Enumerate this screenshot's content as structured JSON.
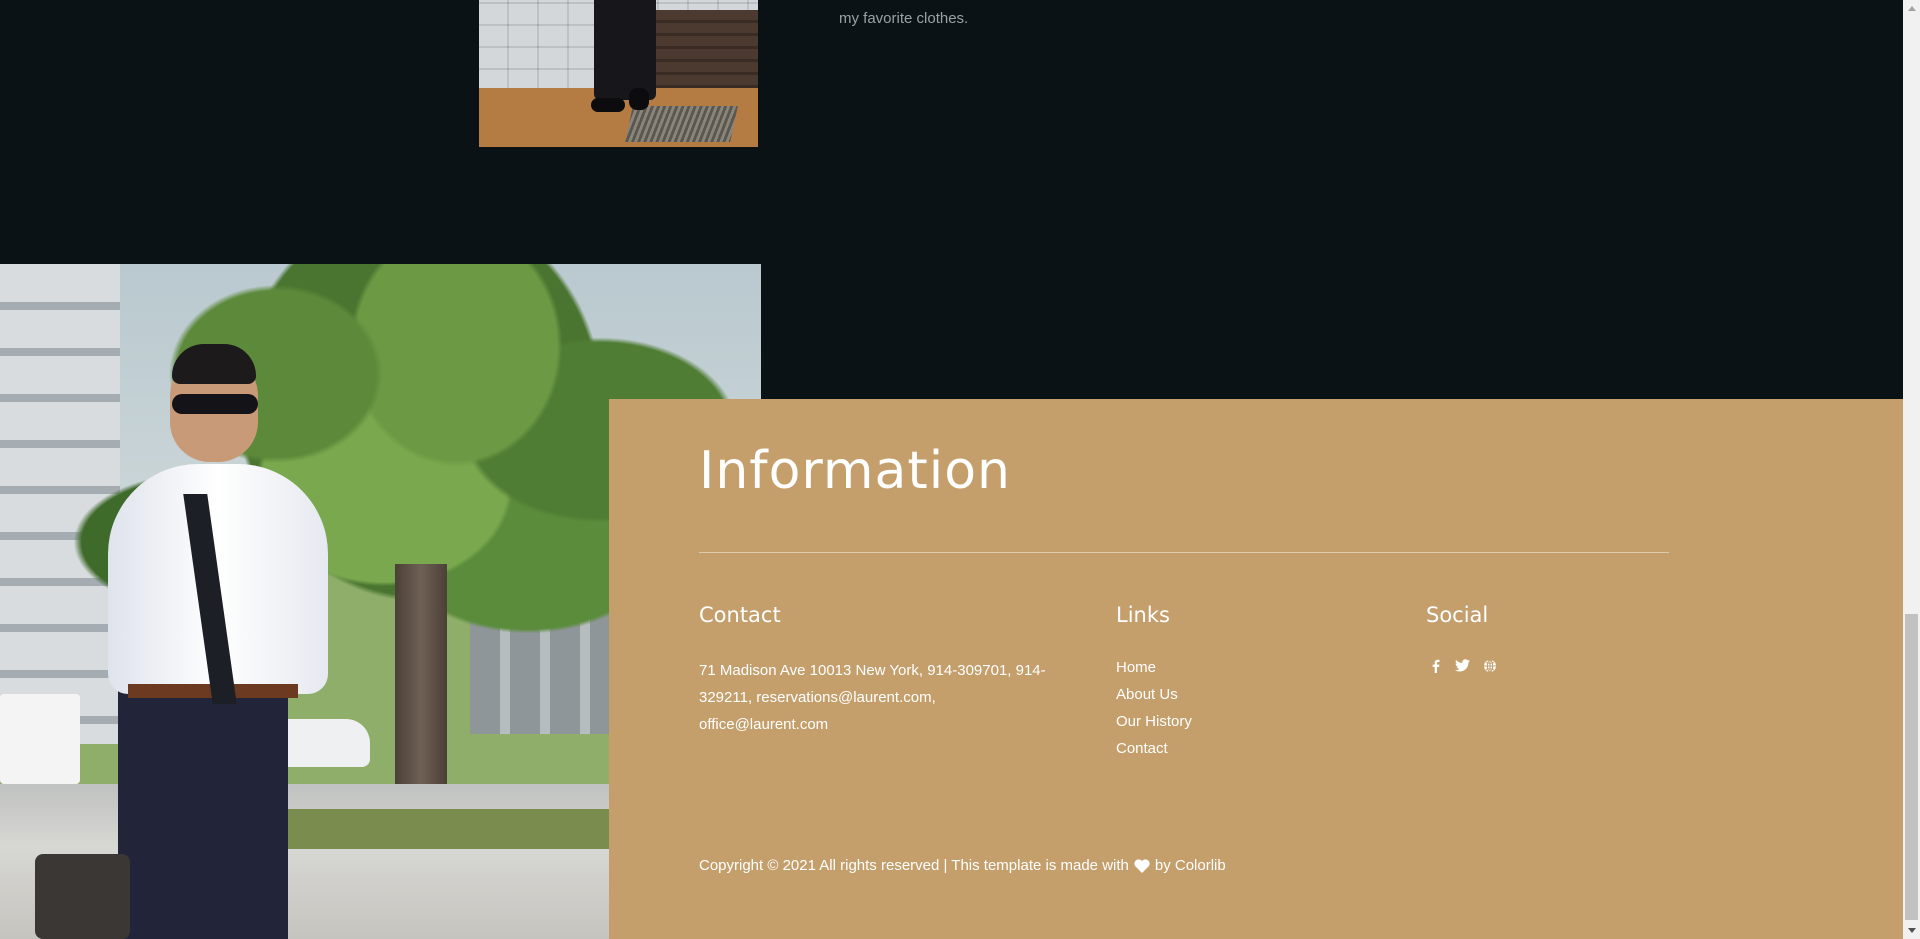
{
  "top_section": {
    "caption_tail": "my favorite clothes."
  },
  "info": {
    "title": "Information",
    "contact": {
      "heading": "Contact",
      "line1": "71 Madison Ave 10013 New York, 914-309701, 914-",
      "line2": "329211, reservations@laurent.com,",
      "line3": "office@laurent.com"
    },
    "links": {
      "heading": "Links",
      "items": [
        "Home",
        "About Us",
        "Our History",
        "Contact"
      ]
    },
    "social": {
      "heading": "Social",
      "icons": [
        "facebook-icon",
        "twitter-icon",
        "globe-icon"
      ]
    },
    "copyright": {
      "before": "Copyright © 2021 All rights reserved | This template is made with",
      "after": "by Colorlib"
    }
  },
  "colors": {
    "page_bg": "#0b1215",
    "panel_bg": "#c49f6c",
    "text": "#ffffff"
  }
}
